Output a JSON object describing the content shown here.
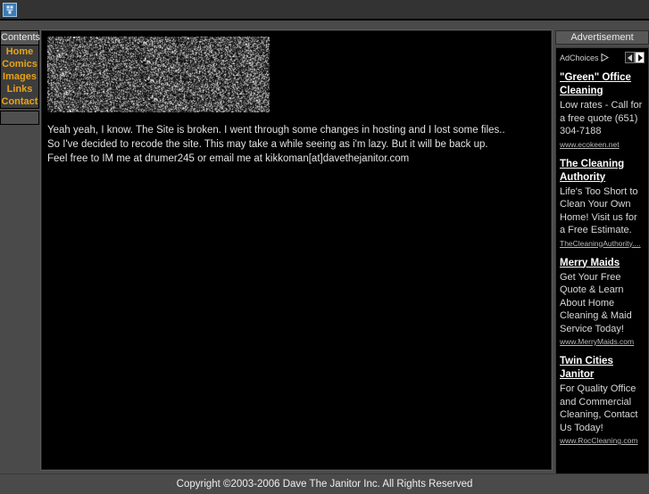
{
  "browser": {
    "icon_name": "broken-image-icon"
  },
  "sidebar": {
    "header": "Contents",
    "items": [
      {
        "label": "Home"
      },
      {
        "label": "Comics"
      },
      {
        "label": "Images"
      },
      {
        "label": "Links"
      },
      {
        "label": "Contact"
      }
    ]
  },
  "main": {
    "banner_alt": "static-noise-banner",
    "post_text": "Yeah yeah, I know. The Site is broken. I went through some changes in hosting and I lost some files..\nSo I've decided to recode the site. This may take a while seeing as i'm lazy. But it will be back up.\nFeel free to IM me at drumer245 or email me at kikkoman[at]davethejanitor.com"
  },
  "ads": {
    "header": "Advertisement",
    "adchoices_label": "AdChoices",
    "items": [
      {
        "title": "\"Green\" Office Cleaning",
        "desc": "Low rates - Call for a free quote (651) 304-7188",
        "url": "www.ecokeen.net"
      },
      {
        "title": "The Cleaning Authority",
        "desc": "Life's Too Short to Clean Your Own Home! Visit us for a Free Estimate.",
        "url": "TheCleaningAuthority...."
      },
      {
        "title": "Merry Maids",
        "desc": "Get Your Free Quote & Learn About Home Cleaning & Maid Service Today!",
        "url": "www.MerryMaids.com"
      },
      {
        "title": "Twin Cities Janitor",
        "desc": "For Quality Office and Commercial Cleaning, Contact Us Today!",
        "url": "www.RocCleaning.com"
      }
    ]
  },
  "footer": {
    "copyright": "Copyright ©2003-2006 Dave The Janitor Inc. All Rights Reserved"
  },
  "colors": {
    "nav_link": "#e8a317",
    "page_bg": "#4a4a4a",
    "content_bg": "#000000"
  }
}
